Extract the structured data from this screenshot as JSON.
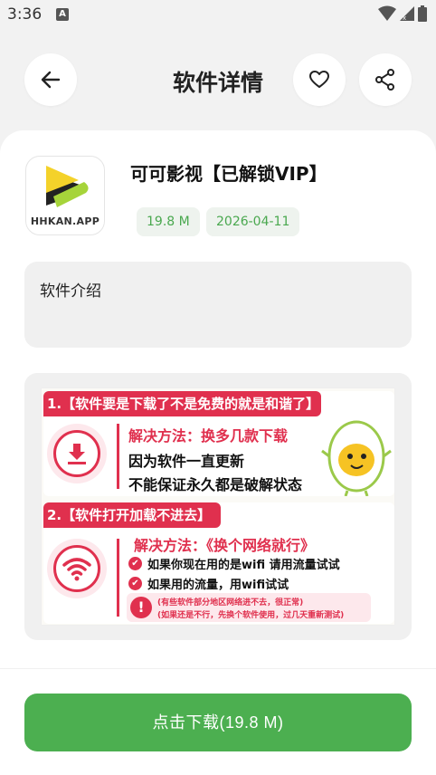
{
  "status_bar": {
    "time": "3:36",
    "notification_badge": "A"
  },
  "header": {
    "title": "软件详情",
    "back_icon": "arrow-left-icon",
    "favorite_icon": "heart-icon",
    "share_icon": "share-icon"
  },
  "app": {
    "name": "可可影视【已解锁VIP】",
    "icon_label": "HHKAN.APP",
    "size": "19.8 M",
    "date": "2026-04-11"
  },
  "intro": {
    "title": "软件介绍"
  },
  "promo": {
    "section1": {
      "banner": "1.【软件要是下载了不是免费的就是和谐了】",
      "method": "解决方法：换多几款下载",
      "line1": "因为软件一直更新",
      "line2": "不能保证永久都是破解状态"
    },
    "section2": {
      "banner": "2.【软件打开加载不进去】",
      "method": "解决方法：《换个网络就行》",
      "check1": "如果你现在用的是wifi 请用流量试试",
      "check2": "如果用的流量，用wifi试试",
      "note1": "(有些软件部分地区网络进不去，很正常)",
      "note2": "(如果还是不行，先换个软件使用，过几天重新测试)"
    }
  },
  "download": {
    "label": "点击下载(19.8 M)"
  },
  "colors": {
    "accent_green": "#4caf50",
    "promo_red": "#e0304e",
    "chip_text": "#4aa84f"
  }
}
